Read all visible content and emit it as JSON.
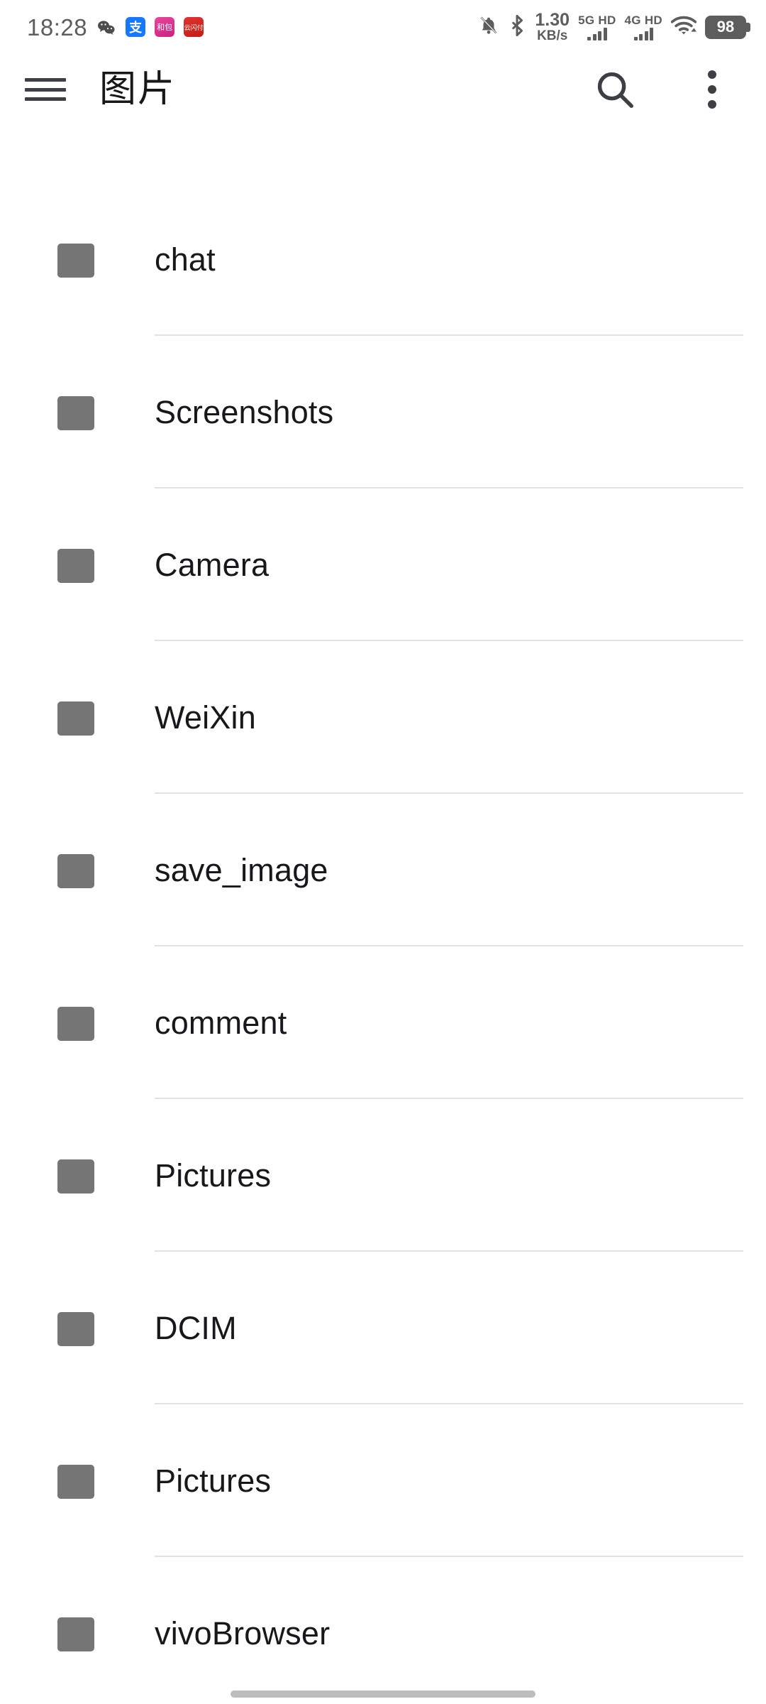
{
  "status_bar": {
    "time": "18:28",
    "app_icons": [
      {
        "name": "wechat-icon",
        "label": ""
      },
      {
        "name": "alipay-icon",
        "label": "支"
      },
      {
        "name": "hebao-icon",
        "label": "和包"
      },
      {
        "name": "yunshanfu-icon",
        "label": "云闪付"
      }
    ],
    "mute_icon": "bell-muted-icon",
    "bluetooth_icon": "bluetooth-icon",
    "network_speed_value": "1.30",
    "network_speed_unit": "KB/s",
    "sim1_label": "5G HD",
    "sim2_label": "4G HD",
    "wifi_icon": "wifi-icon",
    "battery_level": "98",
    "icon_color": "#5d5d5d"
  },
  "toolbar": {
    "menu_icon": "hamburger-menu-icon",
    "title": "图片",
    "search_icon": "search-icon",
    "overflow_icon": "more-vertical-icon",
    "title_color": "#17181a"
  },
  "list": {
    "folder_icon": "folder-icon",
    "folder_color": "#757575",
    "divider_color": "#e2e2e2",
    "items": [
      {
        "label": "chat"
      },
      {
        "label": "Screenshots"
      },
      {
        "label": "Camera"
      },
      {
        "label": "WeiXin"
      },
      {
        "label": "save_image"
      },
      {
        "label": "comment"
      },
      {
        "label": "Pictures"
      },
      {
        "label": "DCIM"
      },
      {
        "label": "Pictures"
      },
      {
        "label": "vivoBrowser"
      }
    ]
  },
  "system": {
    "gesture_bar": "home-gesture-bar"
  }
}
